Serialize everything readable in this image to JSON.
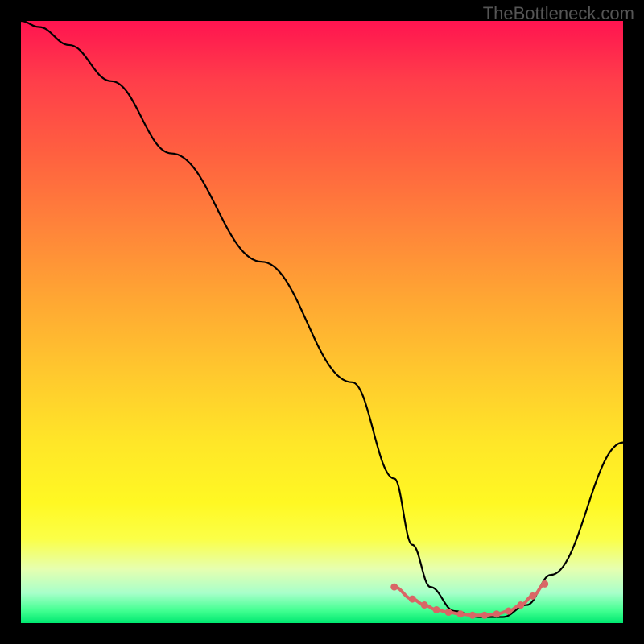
{
  "watermark": "TheBottleneck.com",
  "chart_data": {
    "type": "line",
    "title": "",
    "xlabel": "",
    "ylabel": "",
    "xlim": [
      0,
      100
    ],
    "ylim": [
      0,
      100
    ],
    "series": [
      {
        "name": "bottleneck-curve",
        "x": [
          0,
          3,
          8,
          15,
          25,
          40,
          55,
          62,
          65,
          68,
          72,
          76,
          80,
          84,
          88,
          100
        ],
        "values": [
          100,
          99,
          96,
          90,
          78,
          60,
          40,
          24,
          13,
          6,
          2,
          1,
          1,
          3,
          8,
          30
        ]
      }
    ],
    "markers": {
      "name": "highlight-points",
      "color": "#d96666",
      "x": [
        62,
        65,
        67,
        69,
        71,
        73,
        75,
        77,
        79,
        81,
        83,
        85,
        87
      ],
      "values": [
        6,
        4,
        3,
        2.2,
        1.8,
        1.5,
        1.3,
        1.3,
        1.5,
        2,
        3,
        4.5,
        6.5
      ]
    },
    "highlight_segment": {
      "color": "#d96666",
      "x_start": 62,
      "x_end": 87
    }
  }
}
